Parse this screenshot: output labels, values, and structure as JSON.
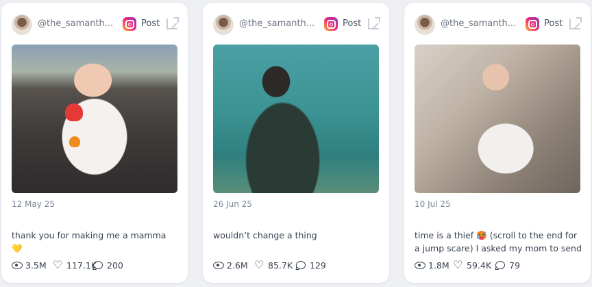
{
  "cards": [
    {
      "handle": "@the_samanth...",
      "source_label": "Post",
      "platform_icon": "instagram-icon",
      "date": "12 May 25",
      "caption": "thank you for making me a mamma 💛",
      "views": "3.5M",
      "likes": "117.1K",
      "comments": "200"
    },
    {
      "handle": "@the_samanth...",
      "source_label": "Post",
      "platform_icon": "instagram-icon",
      "date": "26 Jun 25",
      "caption": "wouldn’t change a thing",
      "views": "2.6M",
      "likes": "85.7K",
      "comments": "129"
    },
    {
      "handle": "@the_samanth...",
      "source_label": "Post",
      "platform_icon": "instagram-icon",
      "date": "10 Jul 25",
      "caption": "time is a thief 🥵 (scroll to the end for a jump scare) I asked my mom to send m...",
      "views": "1.8M",
      "likes": "59.4K",
      "comments": "79"
    }
  ],
  "colors": {
    "page_background": "#eef0f4",
    "card_background": "#ffffff",
    "instagram_gradient": [
      "#f9b233",
      "#ee2a7b",
      "#8a3ab9"
    ],
    "muted_text": "#7b8494"
  }
}
